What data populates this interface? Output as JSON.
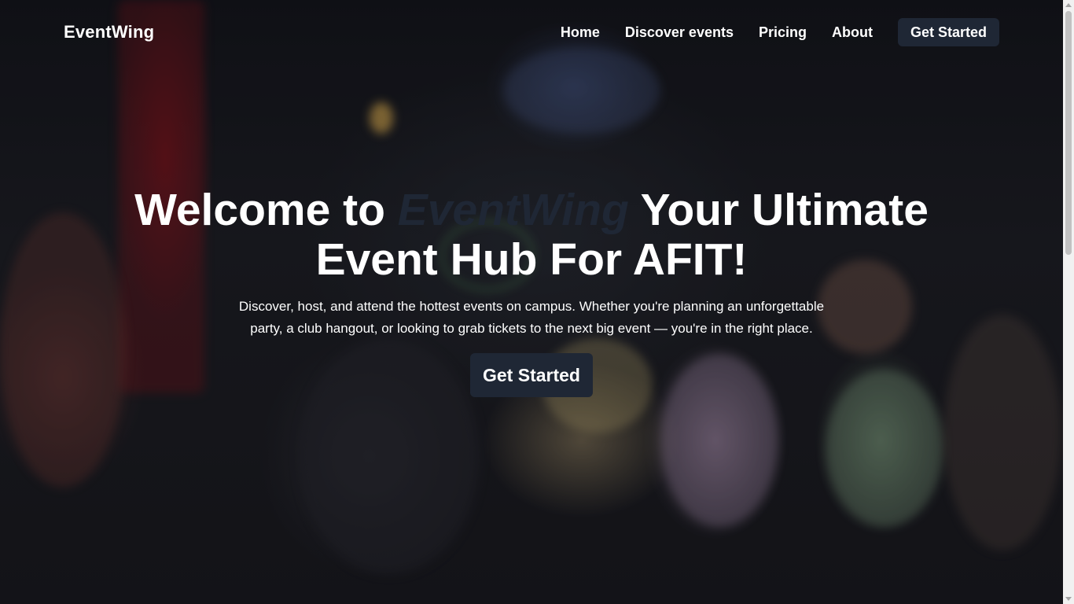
{
  "nav": {
    "logo": "EventWing",
    "links": [
      "Home",
      "Discover events",
      "Pricing",
      "About"
    ],
    "cta": "Get Started"
  },
  "hero": {
    "title_prefix": "Welcome to ",
    "title_brand": "EventWing",
    "title_suffix": " Your Ultimate Event Hub For AFIT!",
    "subtitle": "Discover, host, and attend the hottest events on campus. Whether you're planning an unforgettable party, a club hangout, or looking to grab tickets to the next big event — you're in the right place.",
    "cta": "Get Started"
  },
  "colors": {
    "brand_dark": "#1f2735",
    "text": "#ffffff"
  }
}
